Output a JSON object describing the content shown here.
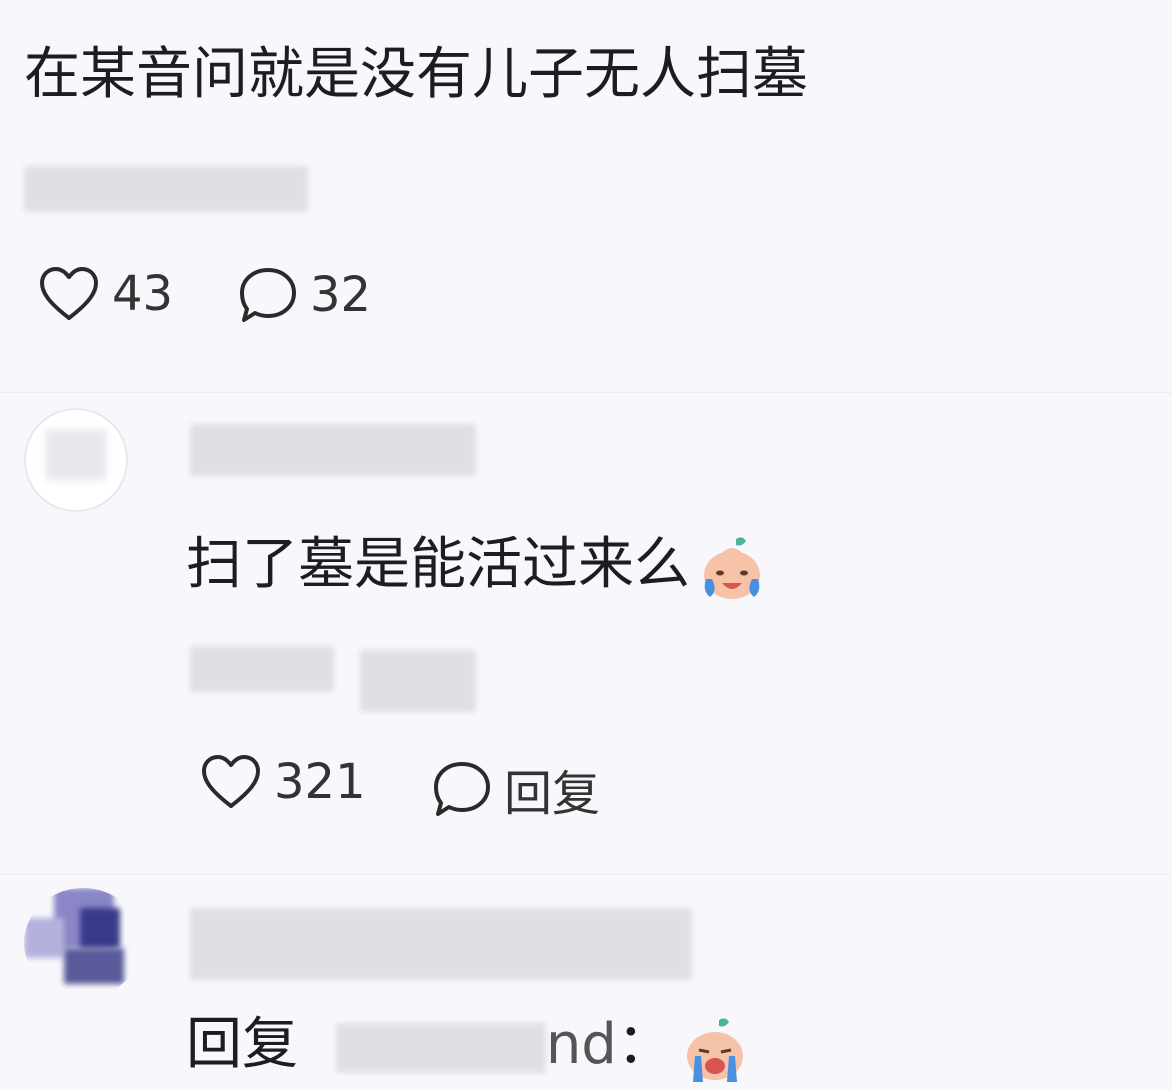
{
  "post": {
    "text": "在某音问就是没有儿子无人扫墓",
    "likes": "43",
    "comments": "32"
  },
  "reply1": {
    "text": "扫了墓是能活过来么",
    "likes": "321",
    "reply_label": "回复"
  },
  "reply2": {
    "prefix": "回复",
    "name_partial": "nd",
    "colon": "："
  },
  "icons": {
    "like": "heart-outline-icon",
    "comment": "speech-bubble-icon",
    "emoji": "crying-laughing-emoji"
  }
}
